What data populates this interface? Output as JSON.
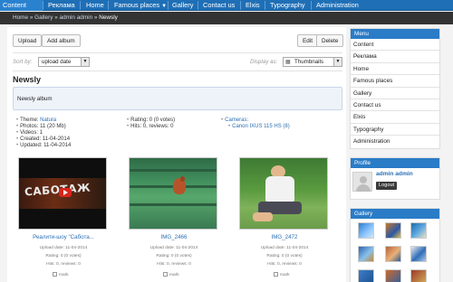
{
  "nav": {
    "items": [
      "Content",
      "Реклама",
      "Home",
      "Famous places",
      "Gallery",
      "Contact us",
      "Elxis",
      "Typography",
      "Administration"
    ]
  },
  "breadcrumb": [
    "Home",
    "Gallery",
    "admin admin",
    "Newsly"
  ],
  "toolbar": {
    "upload_label": "Upload",
    "add_album_label": "Add album",
    "edit_label": "Edit",
    "delete_label": "Delete"
  },
  "sort": {
    "label": "Sort by:",
    "value": "upload date"
  },
  "display": {
    "label": "Display as:",
    "value": "Thumbnails"
  },
  "album": {
    "title": "Newsly",
    "description": "Newsly album",
    "info_left": [
      "Theme: ",
      "Natura",
      "Photos: 11 (20 Mb)",
      "Videos: 1",
      "Created: 11-04-2014",
      "Updated: 11-04-2014"
    ],
    "info_mid": [
      "Rating: 0 (0 votes)",
      "Hits: 0, reviews: 0"
    ],
    "info_right": [
      "Cameras:",
      "Canon IXUS 115 HS (8)"
    ]
  },
  "photos": [
    {
      "name": "Реалити-шоу \"Сабота...",
      "upload": "Upload date: 11-04-2014",
      "rating": "Rating: 0 (0 votes)",
      "hits": "Hits: 0, reviews: 0",
      "mark": "mark",
      "overlay": "САБОТАЖ"
    },
    {
      "name": "IMG_2466",
      "upload": "Upload date: 11-04-2014",
      "rating": "Rating: 0 (0 votes)",
      "hits": "Hits: 0, reviews: 0",
      "mark": "mark"
    },
    {
      "name": "IMG_2472",
      "upload": "Upload date: 11-04-2014",
      "rating": "Rating: 0 (0 votes)",
      "hits": "Hits: 0, reviews: 0",
      "mark": "mark"
    }
  ],
  "sidebar": {
    "menu_title": "Menu",
    "menu_items": [
      "Content",
      "Реклама",
      "Home",
      "Famous places",
      "Gallery",
      "Contact us",
      "Elxis",
      "Typography",
      "Administration"
    ],
    "profile_title": "Profile",
    "username": "admin admin",
    "logout_label": "Logout",
    "gallery_title": "Gallery"
  },
  "colors": {
    "nav": "#1f6fb6",
    "accent": "#2a7cc7",
    "link": "#2a6fb4"
  }
}
